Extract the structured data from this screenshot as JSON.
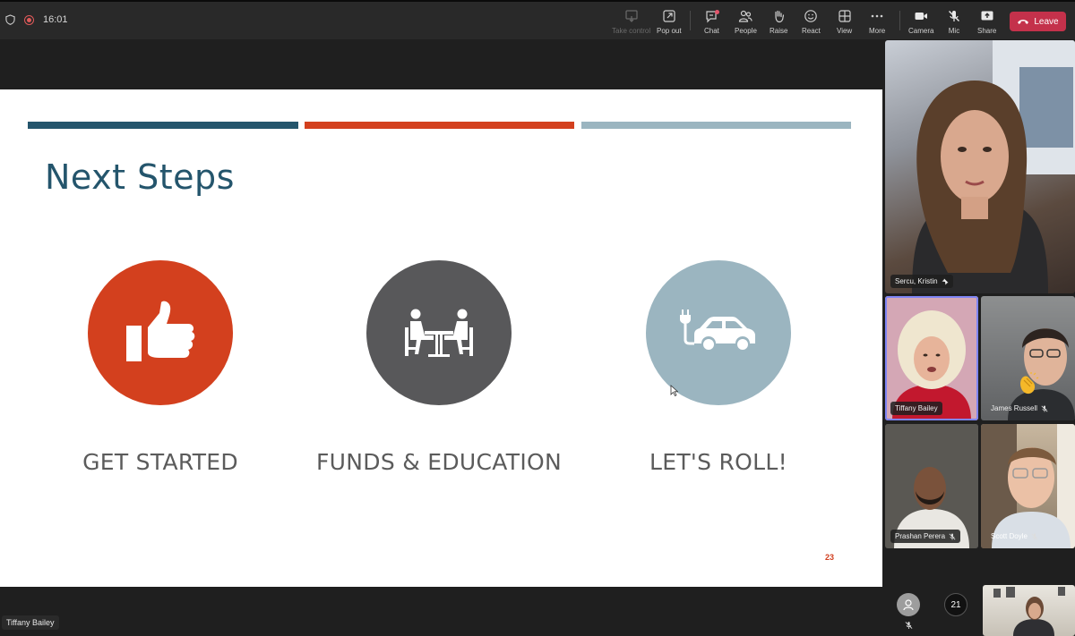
{
  "topbar": {
    "time": "16:01",
    "take_control": "Take control",
    "pop_out": "Pop out",
    "chat": "Chat",
    "people": "People",
    "raise": "Raise",
    "react": "React",
    "view": "View",
    "more": "More",
    "camera": "Camera",
    "mic": "Mic",
    "share": "Share",
    "leave": "Leave"
  },
  "slide": {
    "title": "Next Steps",
    "steps": [
      {
        "label": "GET STARTED",
        "icon": "thumbs-up-icon",
        "color": "#d3401e"
      },
      {
        "label": "FUNDS & EDUCATION",
        "icon": "meeting-table-icon",
        "color": "#58585a"
      },
      {
        "label": "LET'S ROLL!",
        "icon": "electric-car-icon",
        "color": "#9bb5c0"
      }
    ],
    "bars": [
      "#24556c",
      "#d3401e",
      "#9bb5c0"
    ],
    "page_number": "23"
  },
  "presenter": "Tiffany Bailey",
  "participants": [
    {
      "name": "Sercu, Kristin",
      "pinned": true
    },
    {
      "name": "Tiffany Bailey",
      "speaking": true
    },
    {
      "name": "James Russell",
      "muted": true,
      "reaction": "clap"
    },
    {
      "name": "Prashan Perera",
      "muted": true
    },
    {
      "name": "Scott Doyle",
      "muted": true
    }
  ],
  "overflow_count": "21",
  "colors": {
    "accent": "#7f85f5",
    "leave": "#c4314b",
    "title_blue": "#24556c"
  }
}
